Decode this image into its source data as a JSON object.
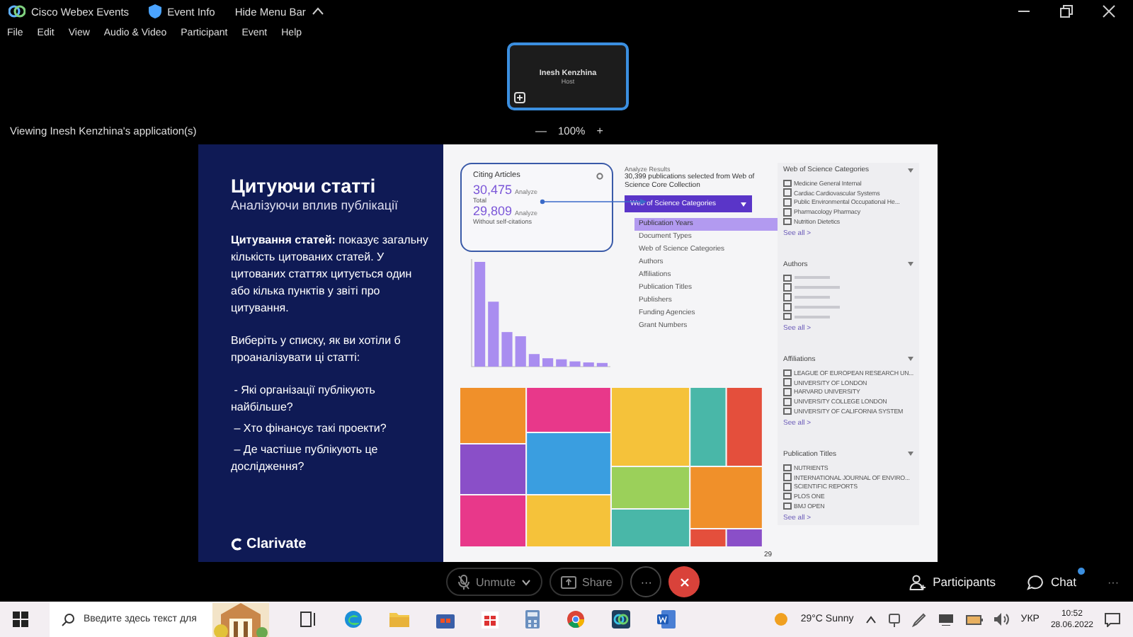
{
  "window": {
    "app_name": "Cisco Webex Events",
    "event_info": "Event Info",
    "hide_menu": "Hide Menu Bar"
  },
  "menu": [
    "File",
    "Edit",
    "View",
    "Audio & Video",
    "Participant",
    "Event",
    "Help"
  ],
  "video_tile": {
    "name": "Inesh Kenzhina",
    "role": "Host"
  },
  "viewing": {
    "label": "Viewing Inesh Kenzhina's application(s)",
    "zoom_out": "—",
    "zoom": "100%",
    "zoom_in": "+"
  },
  "slide": {
    "title": "Цитуючи статті",
    "subtitle": "Аналізуючи вплив публікації",
    "paragraph": "**Цитування статей:** показує загальну кількість цитованих статей. У цитованих статтях цитується один або кілька пунктів у звіті про цитування.",
    "question": "Виберіть у списку, як ви хотіли б проаналізувати ці статті:",
    "bullets": [
      " - Які організації публікують найбільше?",
      " – Хто фінансує такі проекти?",
      " – Де частіше публікують це дослідження?"
    ],
    "logo": "Clarivate",
    "card": {
      "title": "Citing Articles",
      "total": "30,475",
      "total_tag": "Analyze",
      "total_label": "Total",
      "without": "29,809",
      "without_tag": "Analyze",
      "without_label": "Without self-citations"
    },
    "analysis_label": "Analyze Results",
    "analysis_text": "30,399 publications selected from Web of Science Core Collection",
    "dropdown": "Web of Science Categories",
    "options": [
      {
        "label": "Publication Years",
        "selected": true
      },
      {
        "label": "Document Types",
        "selected": false
      },
      {
        "label": "Web of Science Categories",
        "selected": false
      },
      {
        "label": "Authors",
        "selected": false
      },
      {
        "label": "Affiliations",
        "selected": false
      },
      {
        "label": "Publication Titles",
        "selected": false
      },
      {
        "label": "Publishers",
        "selected": false
      },
      {
        "label": "Funding Agencies",
        "selected": false
      },
      {
        "label": "Grant Numbers",
        "selected": false
      }
    ],
    "treemap": [
      {
        "color": "#f0902a"
      },
      {
        "color": "#e8388a"
      },
      {
        "color": "#f5c23a"
      },
      {
        "color": "#49b7a8"
      },
      {
        "color": "#e44f3c"
      },
      {
        "color": "#8a4fc8"
      },
      {
        "color": "#3a9ee0"
      },
      {
        "color": "#9bd05a"
      },
      {
        "color": "#f0902a"
      },
      {
        "color": "#e8388a"
      },
      {
        "color": "#f5c23a"
      },
      {
        "color": "#49b7a8"
      },
      {
        "color": "#e44f3c"
      },
      {
        "color": "#8a4fc8"
      }
    ],
    "filters": [
      {
        "title": "Web of Science Categories",
        "items": [
          {
            "label": "Medicine General Internal",
            "checked": false
          },
          {
            "label": "Cardiac Cardiovascular Systems",
            "checked": false
          },
          {
            "label": "Public Environmental Occupational He...",
            "checked": false
          },
          {
            "label": "Pharmacology Pharmacy",
            "checked": false
          },
          {
            "label": "Nutrition Dietetics",
            "checked": false
          }
        ],
        "see_all": "See all >"
      },
      {
        "title": "Authors",
        "items": [
          {
            "checked": false
          },
          {
            "checked": false
          },
          {
            "checked": false
          },
          {
            "checked": false
          },
          {
            "checked": false
          }
        ],
        "see_all": "See all >"
      },
      {
        "title": "Affiliations",
        "items": [
          {
            "label": "LEAGUE OF EUROPEAN RESEARCH UN...",
            "checked": false
          },
          {
            "label": "UNIVERSITY OF LONDON",
            "checked": false
          },
          {
            "label": "HARVARD UNIVERSITY",
            "checked": false
          },
          {
            "label": "UNIVERSITY COLLEGE LONDON",
            "checked": false
          },
          {
            "label": "UNIVERSITY OF CALIFORNIA SYSTEM",
            "checked": false
          }
        ],
        "see_all": "See all >"
      },
      {
        "title": "Publication Titles",
        "items": [
          {
            "label": "NUTRIENTS",
            "checked": false
          },
          {
            "label": "INTERNATIONAL JOURNAL OF ENVIRO...",
            "checked": false
          },
          {
            "label": "SCIENTIFIC REPORTS",
            "checked": false
          },
          {
            "label": "PLOS ONE",
            "checked": false
          },
          {
            "label": "BMJ OPEN",
            "checked": false
          }
        ],
        "see_all": "See all >"
      }
    ],
    "page": "29"
  },
  "controls": {
    "unmute": "Unmute",
    "share": "Share",
    "more": "···",
    "participants": "Participants",
    "chat": "Chat",
    "chat_unread": true,
    "overflow": "···"
  },
  "taskbar": {
    "search_placeholder": "Введите здесь текст для",
    "weather": "29°C  Sunny",
    "language": "УКР",
    "time": "10:52",
    "date": "28.06.2022"
  }
}
